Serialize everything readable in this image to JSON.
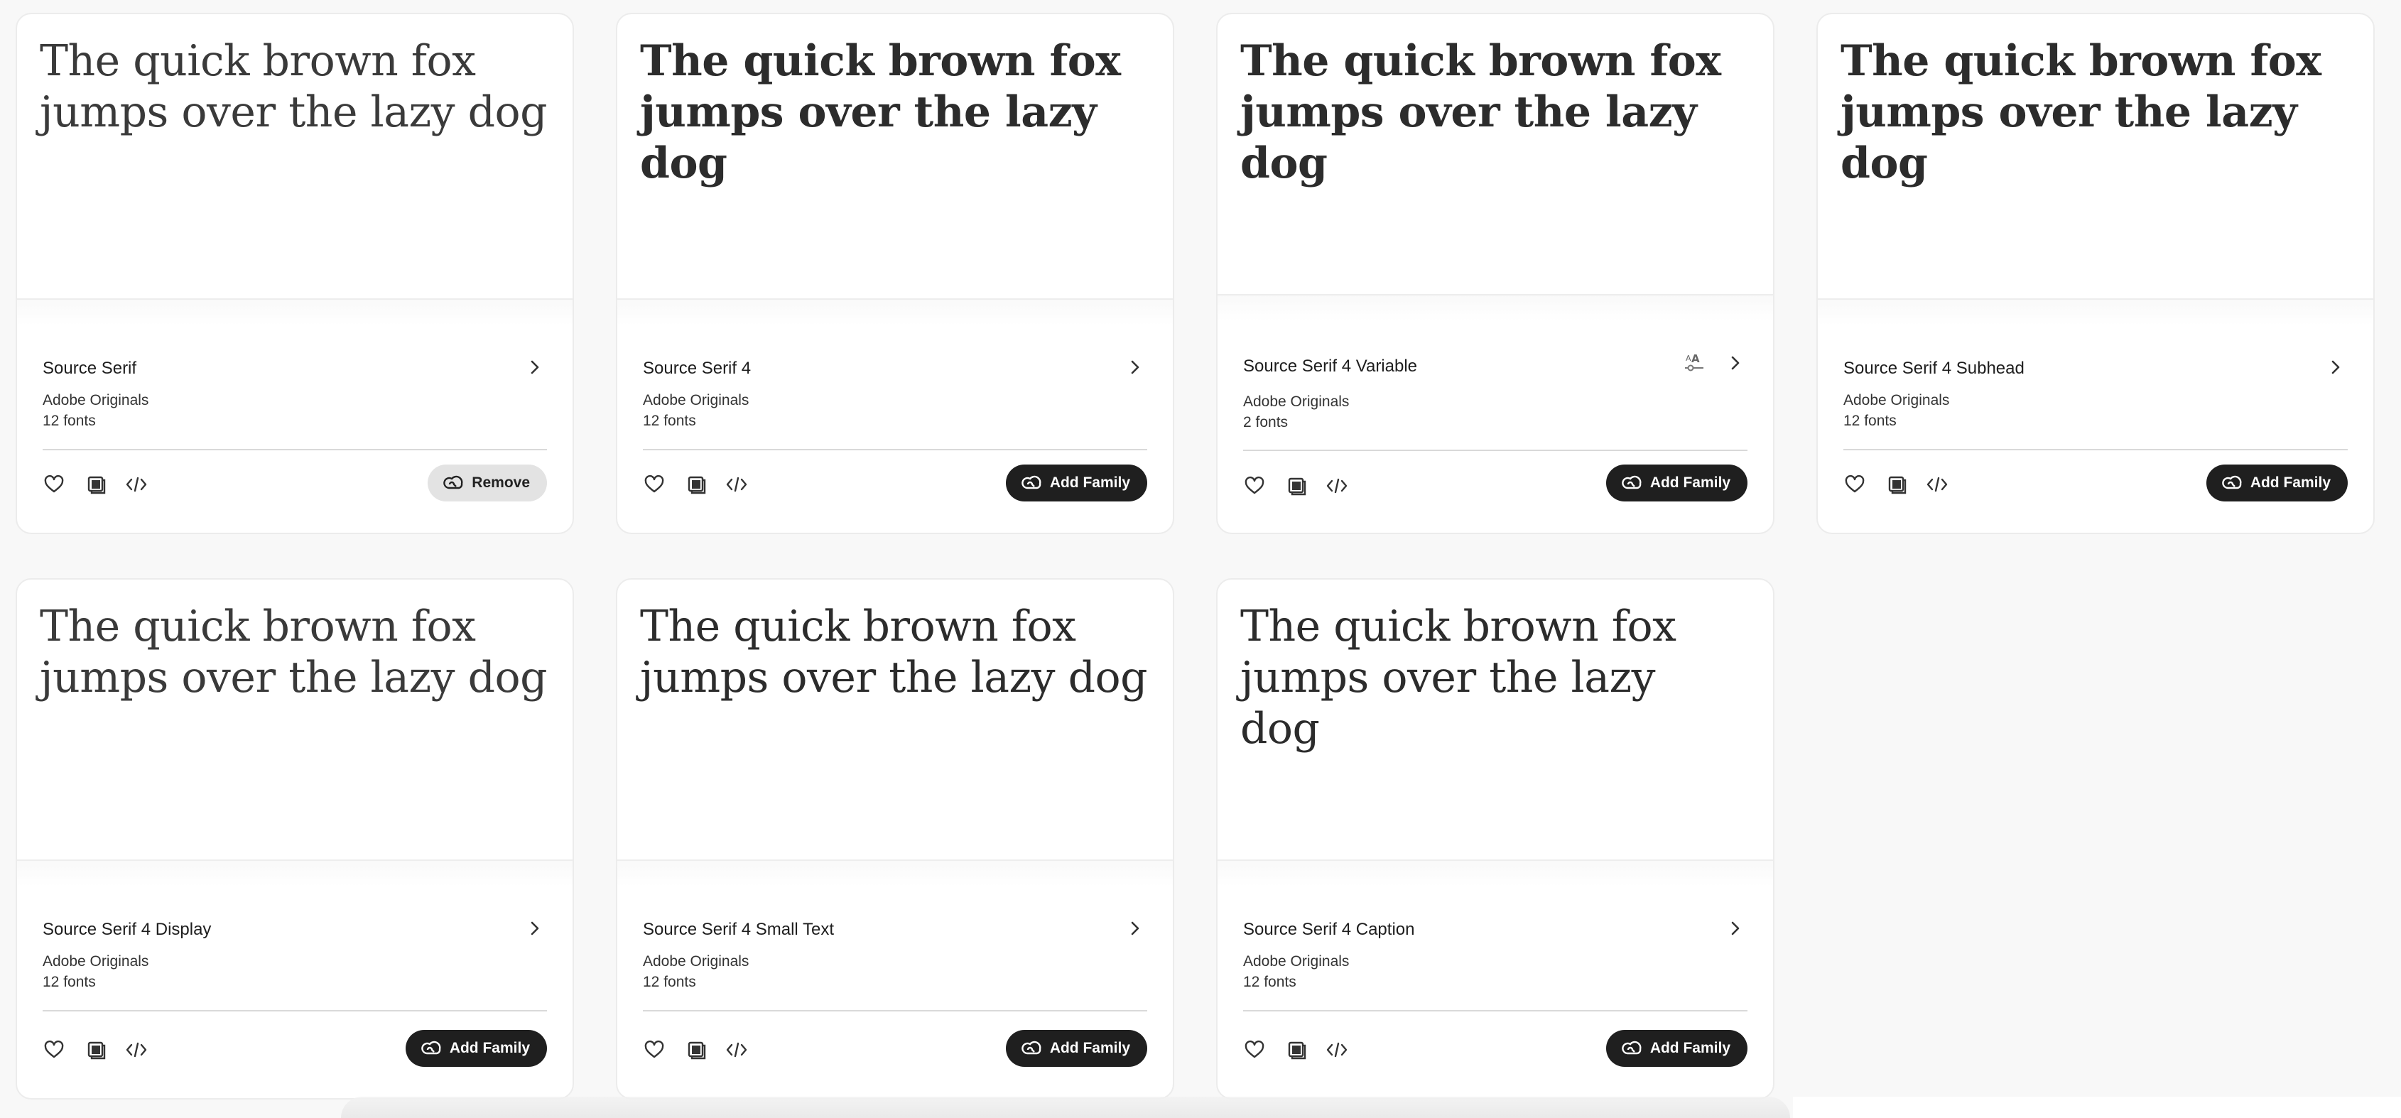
{
  "sample_text": "The quick brown fox jumps over the lazy dog",
  "cards": [
    {
      "name": "Source Serif",
      "foundry": "Adobe Originals",
      "count": "12 fonts",
      "action": "Remove",
      "weight": "light",
      "variable": false
    },
    {
      "name": "Source Serif 4",
      "foundry": "Adobe Originals",
      "count": "12 fonts",
      "action": "Add Family",
      "weight": "bold",
      "variable": false
    },
    {
      "name": "Source Serif 4 Variable",
      "foundry": "Adobe Originals",
      "count": "2 fonts",
      "action": "Add Family",
      "weight": "semi",
      "variable": true
    },
    {
      "name": "Source Serif 4 Subhead",
      "foundry": "Adobe Originals",
      "count": "12 fonts",
      "action": "Add Family",
      "weight": "semi",
      "variable": false
    },
    {
      "name": "Source Serif 4 Display",
      "foundry": "Adobe Originals",
      "count": "12 fonts",
      "action": "Add Family",
      "weight": "light",
      "variable": false
    },
    {
      "name": "Source Serif 4 Small Text",
      "foundry": "Adobe Originals",
      "count": "12 fonts",
      "action": "Add Family",
      "weight": "regular",
      "variable": false
    },
    {
      "name": "Source Serif 4 Caption",
      "foundry": "Adobe Originals",
      "count": "12 fonts",
      "action": "Add Family",
      "weight": "regular",
      "variable": false
    }
  ],
  "icons": {
    "favorite": "heart-icon",
    "copy": "copy-icon",
    "embed": "code-icon",
    "details": "chevron-right-icon",
    "variable": "variable-font-icon",
    "action": "creative-cloud-icon"
  },
  "colors": {
    "add_button_bg": "#1f1f1f",
    "remove_button_bg": "#e3e3e3",
    "card_bg": "#ffffff",
    "page_bg": "#f8f8f8"
  }
}
